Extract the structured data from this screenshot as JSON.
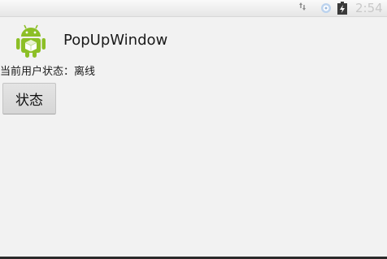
{
  "status_bar": {
    "time": "2:54",
    "icons": [
      "signal-arrows-icon",
      "gps-icon",
      "battery-charging-icon"
    ]
  },
  "app": {
    "title": "PopUpWindow",
    "icon": "android-robot-icon"
  },
  "content": {
    "user_state_text": "当前用户状态：离线",
    "state_button_label": "状态"
  },
  "colors": {
    "background": "#f2f2f2",
    "android_green": "#8cbf26",
    "button_bg": "#dcdcdc"
  }
}
